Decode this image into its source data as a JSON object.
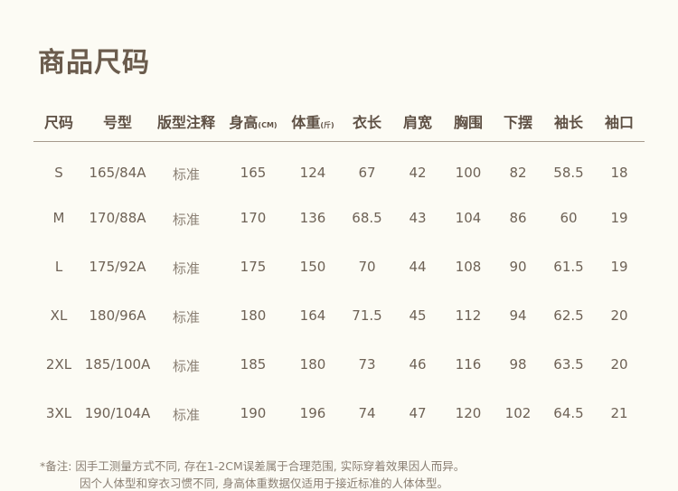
{
  "title": "商品尺码",
  "headers": [
    {
      "label": "尺码",
      "unit": ""
    },
    {
      "label": "号型",
      "unit": ""
    },
    {
      "label": "版型注释",
      "unit": ""
    },
    {
      "label": "身高",
      "unit": "(CM)"
    },
    {
      "label": "体重",
      "unit": "(斤)"
    },
    {
      "label": "衣长",
      "unit": ""
    },
    {
      "label": "肩宽",
      "unit": ""
    },
    {
      "label": "胸围",
      "unit": ""
    },
    {
      "label": "下摆",
      "unit": ""
    },
    {
      "label": "袖长",
      "unit": ""
    },
    {
      "label": "袖口",
      "unit": ""
    }
  ],
  "rows": [
    [
      "S",
      "165/84A",
      "标准",
      "165",
      "124",
      "67",
      "42",
      "100",
      "82",
      "58.5",
      "18"
    ],
    [
      "M",
      "170/88A",
      "标准",
      "170",
      "136",
      "68.5",
      "43",
      "104",
      "86",
      "60",
      "19"
    ],
    [
      "L",
      "175/92A",
      "标准",
      "175",
      "150",
      "70",
      "44",
      "108",
      "90",
      "61.5",
      "19"
    ],
    [
      "XL",
      "180/96A",
      "标准",
      "180",
      "164",
      "71.5",
      "45",
      "112",
      "94",
      "62.5",
      "20"
    ],
    [
      "2XL",
      "185/100A",
      "标准",
      "185",
      "180",
      "73",
      "46",
      "116",
      "98",
      "63.5",
      "20"
    ],
    [
      "3XL",
      "190/104A",
      "标准",
      "190",
      "196",
      "74",
      "47",
      "120",
      "102",
      "64.5",
      "21"
    ]
  ],
  "notes": {
    "line1": "*备注: 因手工测量方式不同, 存在1-2CM误差属于合理范围, 实际穿着效果因人而异。",
    "line2": "因个人体型和穿衣习惯不同, 身高体重数据仅适用于接近标准的人体体型。"
  }
}
